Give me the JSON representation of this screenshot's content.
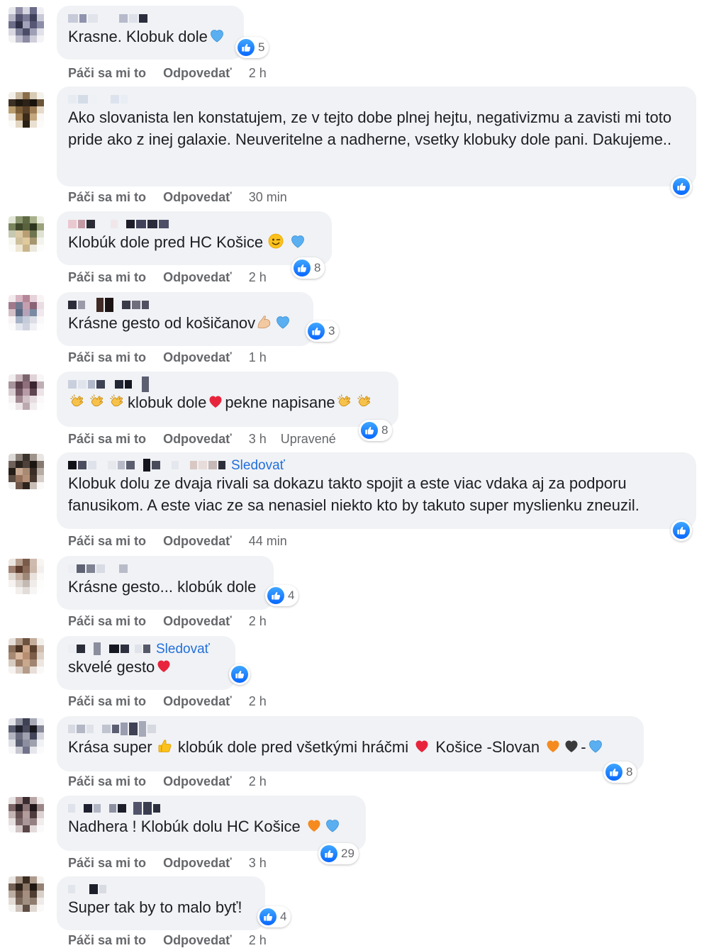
{
  "actions": {
    "like": "Páči sa mi to",
    "reply": "Odpovedať"
  },
  "follow_label": "Sledovať",
  "edited_label": "Upravené",
  "comments": [
    {
      "text": "Krasne. Klobuk dole",
      "time": "2 h",
      "count": "5"
    },
    {
      "text": "Ako slovanista len konstatujem, ze v tejto dobe plnej hejtu, negativizmu a zavisti mi toto pride ako z inej galaxie. Neuveritelne a nadherne, vsetky klobuky dole pani. Dakujeme..",
      "time": "30 min"
    },
    {
      "text": "Klobúk dole pred HC Košice",
      "time": "2 h",
      "count": "8"
    },
    {
      "text": "Krásne gesto od košičanov",
      "time": "1 h",
      "count": "3"
    },
    {
      "text_a": "klobuk dole",
      "text_b": "pekne napisane",
      "time": "3 h",
      "count": "8"
    },
    {
      "text": "Klobuk dolu ze dvaja rivali sa dokazu takto spojit a este viac vdaka aj za podporu fanusikom. A este viac ze sa nenasiel niekto kto by takuto super myslienku zneuzil.",
      "time": "44 min"
    },
    {
      "text": "Krásne gesto... klobúk dole",
      "time": "2 h",
      "count": "4"
    },
    {
      "text": "skvelé gesto",
      "time": "2 h"
    },
    {
      "text_a": "Krása super",
      "text_b": "klobúk dole pred všetkými hráčmi",
      "text_c": "Košice -Slovan",
      "text_d": "-",
      "time": "2 h",
      "count": "8"
    },
    {
      "text": "Nadhera ! Klobúk dolu HC Košice",
      "time": "3 h",
      "count": "29"
    },
    {
      "text": "Super tak by to malo byť!",
      "time": "2 h",
      "count": "4"
    }
  ],
  "colors": {
    "bubble": "#f0f2f5",
    "meta": "#65676b",
    "link": "#216fdb",
    "like": "#0866ff"
  },
  "icons": [
    "like-icon",
    "blue-heart-emoji",
    "red-heart-emoji",
    "orange-heart-emoji",
    "black-heart-emoji",
    "wink-emoji",
    "clap-emoji",
    "flexed-biceps-emoji",
    "thumbs-up-emoji"
  ]
}
